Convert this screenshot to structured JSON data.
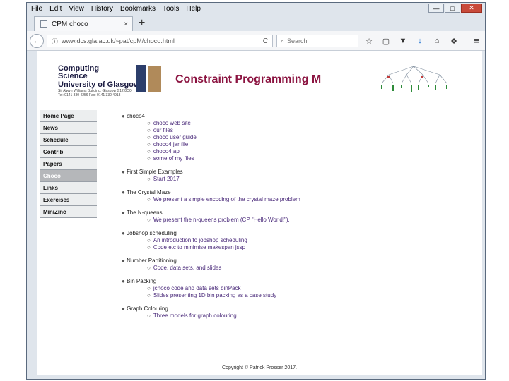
{
  "menubar": [
    "File",
    "Edit",
    "View",
    "History",
    "Bookmarks",
    "Tools",
    "Help"
  ],
  "window_controls": {
    "min": "—",
    "max": "□",
    "close": "✕"
  },
  "tab": {
    "title": "CPM choco",
    "close": "×",
    "new_tab": "+"
  },
  "nav": {
    "back": "←",
    "url": "www.dcs.gla.ac.uk/~pat/cpM/choco.html",
    "reload": "C",
    "search_placeholder": "Search",
    "search_icon": "⌕",
    "toolbar_icons": [
      "☆",
      "▢",
      "▼",
      "↓",
      "⌂",
      "❖"
    ],
    "menu_icon": "≡"
  },
  "logo": {
    "line1": "Computing",
    "line2": "Science",
    "line3": "University of Glasgow",
    "line4": "Sir Alwyn Williams Building, Glasgow G12 8QQ",
    "line5": "Tel: 0141 330 4256 Fax: 0141 330 4913"
  },
  "page_title": "Constraint Programming M",
  "sidebar": [
    {
      "label": "Home Page",
      "active": false
    },
    {
      "label": "News",
      "active": false
    },
    {
      "label": "Schedule",
      "active": false
    },
    {
      "label": "Contrib",
      "active": false
    },
    {
      "label": "Papers",
      "active": false
    },
    {
      "label": "Choco",
      "active": true
    },
    {
      "label": "Links",
      "active": false
    },
    {
      "label": "Exercises",
      "active": false
    },
    {
      "label": "MiniZinc",
      "active": false
    }
  ],
  "bullet": "●",
  "sub_bullet": "○",
  "sections": [
    {
      "title": "choco4",
      "items": [
        "choco web site",
        "our files",
        "choco user guide",
        "choco4 jar file",
        "choco4 api",
        "some of my files"
      ]
    },
    {
      "title": "First Simple Examples",
      "items": [
        "Start 2017"
      ]
    },
    {
      "title": "The Crystal Maze",
      "items": [
        "We present a simple encoding of the crystal maze problem"
      ]
    },
    {
      "title": "The N-queens",
      "items": [
        "We present the n-queens problem (CP \"Hello World!\")."
      ]
    },
    {
      "title": "Jobshop scheduling",
      "items": [
        "An introduction to jobshop scheduling",
        "Code etc to minimise makespan jssp"
      ]
    },
    {
      "title": "Number Partitioning",
      "items": [
        "Code, data sets, and slides"
      ]
    },
    {
      "title": "Bin Packing",
      "items": [
        "jchoco code and data sets binPack",
        "Slides presenting 1D bin packing as a case study"
      ]
    },
    {
      "title": "Graph Colouring",
      "items": [
        "Three models for graph colouring"
      ]
    }
  ],
  "footer": "Copyright © Patrick Prosser 2017."
}
